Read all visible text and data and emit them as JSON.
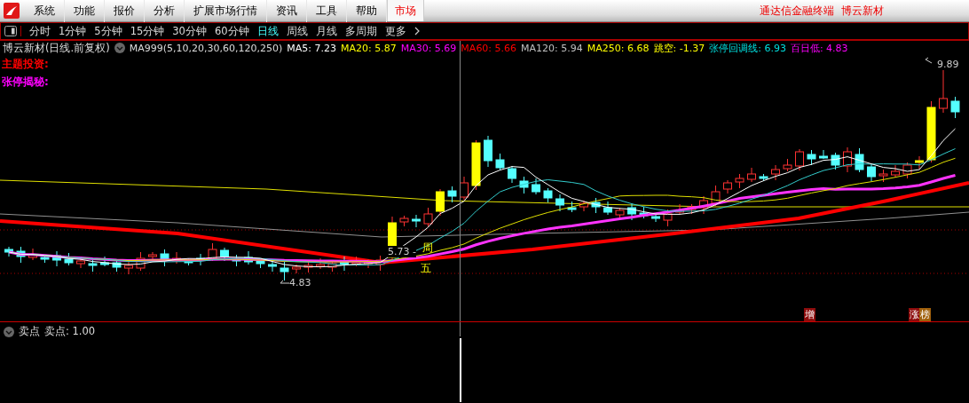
{
  "menu_bar": {
    "items": [
      {
        "label": "系统"
      },
      {
        "label": "功能"
      },
      {
        "label": "报价"
      },
      {
        "label": "分析"
      },
      {
        "label": "扩展市场行情"
      },
      {
        "label": "资讯"
      },
      {
        "label": "工具"
      },
      {
        "label": "帮助"
      }
    ],
    "market_tab": {
      "label": "市场",
      "selected": true
    },
    "title": "通达信金融终端  博云新材"
  },
  "period_bar": {
    "items": [
      {
        "label": "分时",
        "selected": false
      },
      {
        "label": "1分钟",
        "selected": false
      },
      {
        "label": "5分钟",
        "selected": false
      },
      {
        "label": "15分钟",
        "selected": false
      },
      {
        "label": "30分钟",
        "selected": false
      },
      {
        "label": "60分钟",
        "selected": false
      },
      {
        "label": "日线",
        "selected": true
      },
      {
        "label": "周线",
        "selected": false
      },
      {
        "label": "月线",
        "selected": false
      },
      {
        "label": "多周期",
        "selected": false
      }
    ],
    "more": "更多"
  },
  "info_line": {
    "title": "博云新材(日线.前复权)",
    "indicator": "MA999(5,10,20,30,60,120,250)",
    "values": [
      {
        "label": "MA5: 7.23",
        "color": "#ffffff"
      },
      {
        "label": "MA20: 5.87",
        "color": "#ffff00"
      },
      {
        "label": "MA30: 5.69",
        "color": "#ff00ff"
      },
      {
        "label": "MA60: 5.66",
        "color": "#ff0000"
      },
      {
        "label": "MA120: 5.94",
        "color": "#c0c0c0"
      },
      {
        "label": "MA250: 6.68",
        "color": "#ffff00"
      },
      {
        "label": "跳空: -1.37",
        "color": "#ffff00"
      },
      {
        "label": "张停回调线: 6.93",
        "color": "#00e0e0"
      },
      {
        "label": "百日低: 4.83",
        "color": "#ff00ff"
      }
    ]
  },
  "notes": [
    {
      "label": "主题投资:",
      "color": "#ff0000"
    },
    {
      "label": "张停揭秘:",
      "color": "#ff00ff"
    }
  ],
  "chart": {
    "high_label": "9.89",
    "low_label": "4.83",
    "tooltip_price": "5.73 -",
    "tooltip_weekday": [
      "周",
      "五"
    ],
    "badges": [
      {
        "label": "增",
        "color": "#8c0c0c"
      },
      {
        "label": "涨",
        "color": "#8c0c0c"
      },
      {
        "label": "榜",
        "color": "#a0600c"
      }
    ]
  },
  "sub_panel": {
    "name": "卖点",
    "value": "卖点: 1.00"
  }
}
